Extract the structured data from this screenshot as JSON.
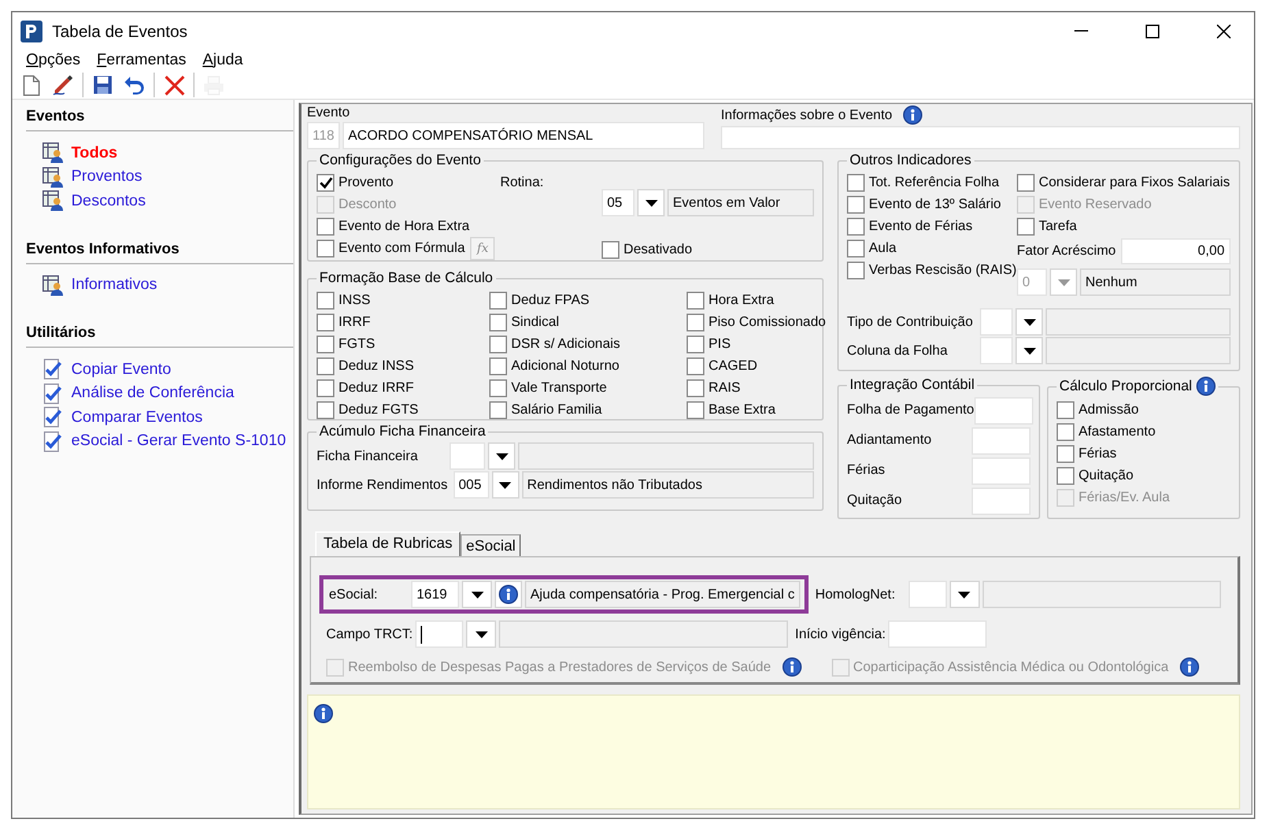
{
  "window": {
    "title": "Tabela de Eventos"
  },
  "menu": [
    {
      "label": "Opções"
    },
    {
      "label": "Ferramentas"
    },
    {
      "label": "Ajuda"
    }
  ],
  "toolbar": [
    {
      "kind": "new",
      "disabled": false
    },
    {
      "kind": "edit",
      "disabled": false
    },
    {
      "kind": "sep"
    },
    {
      "kind": "save",
      "disabled": false
    },
    {
      "kind": "undo",
      "disabled": false
    },
    {
      "kind": "sep"
    },
    {
      "kind": "delete",
      "disabled": false
    },
    {
      "kind": "sep"
    },
    {
      "kind": "print",
      "disabled": true
    }
  ],
  "sidebar": [
    {
      "title": "Eventos",
      "items": [
        {
          "label": "Todos",
          "kind": "table",
          "selected": true
        },
        {
          "label": "Proventos",
          "kind": "table",
          "selected": false
        },
        {
          "label": "Descontos",
          "kind": "table",
          "selected": false
        }
      ]
    },
    {
      "title": "Eventos Informativos",
      "items": [
        {
          "label": "Informativos",
          "kind": "table",
          "selected": false
        }
      ]
    },
    {
      "title": "Utilitários",
      "items": [
        {
          "label": "Copiar Evento",
          "kind": "check",
          "selected": false
        },
        {
          "label": "Análise de Conferência",
          "kind": "check",
          "selected": false
        },
        {
          "label": "Comparar Eventos",
          "kind": "check",
          "selected": false
        },
        {
          "label": "eSocial - Gerar Evento S-1010",
          "kind": "check",
          "selected": false
        }
      ]
    }
  ],
  "evento": {
    "label": "Evento",
    "code": "118",
    "name": "ACORDO COMPENSATÓRIO MENSAL"
  },
  "informacoes": {
    "label": "Informações sobre o Evento"
  },
  "configuracoes": {
    "title": "Configurações do Evento",
    "checks": [
      {
        "label": "Provento",
        "checked": true,
        "disabled": false
      },
      {
        "label": "Desconto",
        "checked": false,
        "disabled": true
      },
      {
        "label": "Evento de Hora Extra",
        "checked": false,
        "disabled": false
      },
      {
        "label": "Evento com Fórmula",
        "checked": false,
        "disabled": false
      }
    ],
    "formula_button": "fx",
    "rotina": {
      "label": "Rotina:",
      "code": "05",
      "description": "Eventos em Valor"
    },
    "desativado": {
      "label": "Desativado",
      "checked": false,
      "disabled": false
    }
  },
  "formacao": {
    "title": "Formação Base de Cálculo",
    "columns": [
      [
        {
          "label": "INSS",
          "checked": false
        },
        {
          "label": "IRRF",
          "checked": false
        },
        {
          "label": "FGTS",
          "checked": false
        },
        {
          "label": "Deduz INSS",
          "checked": false
        },
        {
          "label": "Deduz IRRF",
          "checked": false
        },
        {
          "label": "Deduz FGTS",
          "checked": false
        }
      ],
      [
        {
          "label": "Deduz FPAS",
          "checked": false
        },
        {
          "label": "Sindical",
          "checked": false
        },
        {
          "label": "DSR s/ Adicionais",
          "checked": false
        },
        {
          "label": "Adicional Noturno",
          "checked": false
        },
        {
          "label": "Vale Transporte",
          "checked": false
        },
        {
          "label": "Salário Familia",
          "checked": false
        }
      ],
      [
        {
          "label": "Hora Extra",
          "checked": false
        },
        {
          "label": "Piso Comissionado",
          "checked": false
        },
        {
          "label": "PIS",
          "checked": false
        },
        {
          "label": "CAGED",
          "checked": false
        },
        {
          "label": "RAIS",
          "checked": false
        },
        {
          "label": "Base Extra",
          "checked": false
        }
      ]
    ]
  },
  "acumulo": {
    "title": "Acúmulo Ficha Financeira",
    "rows": [
      {
        "label": "Ficha Financeira"
      },
      {
        "label": "Informe Rendimentos",
        "code": "005",
        "description": "Rendimentos não Tributados"
      }
    ]
  },
  "outros": {
    "title": "Outros Indicadores",
    "left": [
      {
        "label": "Tot. Referência Folha",
        "checked": false,
        "disabled": false
      },
      {
        "label": "Evento de 13º Salário",
        "checked": false,
        "disabled": false
      },
      {
        "label": "Evento de Férias",
        "checked": false,
        "disabled": false
      },
      {
        "label": "Aula",
        "checked": false,
        "disabled": false
      },
      {
        "label": "Verbas Rescisão (RAIS)",
        "checked": false,
        "disabled": false
      }
    ],
    "right": [
      {
        "label": "Considerar para Fixos Salariais",
        "checked": false,
        "disabled": false
      },
      {
        "label": "Evento Reservado",
        "checked": false,
        "disabled": true
      },
      {
        "label": "Tarefa",
        "checked": false,
        "disabled": false
      }
    ],
    "fator": {
      "label": "Fator Acréscimo",
      "value": "0,00"
    },
    "rais": {
      "code": "0",
      "description": "Nenhum",
      "disabled": true
    },
    "lookups": [
      {
        "label": "Tipo de Contribuição"
      },
      {
        "label": "Coluna da Folha"
      }
    ]
  },
  "integracao": {
    "title": "Integração Contábil",
    "fields": [
      {
        "label": "Folha de Pagamento"
      },
      {
        "label": "Adiantamento"
      },
      {
        "label": "Férias"
      },
      {
        "label": "Quitação"
      }
    ]
  },
  "calculo": {
    "title": "Cálculo Proporcional",
    "checks": [
      {
        "label": "Admissão",
        "checked": false,
        "disabled": false
      },
      {
        "label": "Afastamento",
        "checked": false,
        "disabled": false
      },
      {
        "label": "Férias",
        "checked": false,
        "disabled": false
      },
      {
        "label": "Quitação",
        "checked": false,
        "disabled": false
      },
      {
        "label": "Férias/Ev. Aula",
        "checked": false,
        "disabled": true
      }
    ]
  },
  "tabs": [
    {
      "label": "Tabela de Rubricas",
      "selected": true
    },
    {
      "label": "eSocial",
      "selected": false
    }
  ],
  "rubricas": {
    "esocial": {
      "label": "eSocial:",
      "code": "1619",
      "description": "Ajuda compensatória - Prog. Emergencial c",
      "highlighted": true
    },
    "homolognet": {
      "label": "HomologNet:"
    },
    "campo_trct": {
      "label": "Campo TRCT:"
    },
    "inicio": {
      "label": "Início vigência:"
    },
    "checks": [
      {
        "label": "Reembolso de Despesas Pagas a Prestadores de Serviços de Saúde",
        "checked": false,
        "disabled": true
      },
      {
        "label": "Coparticipação Assistência Médica ou Odontológica",
        "checked": false,
        "disabled": true
      }
    ]
  }
}
